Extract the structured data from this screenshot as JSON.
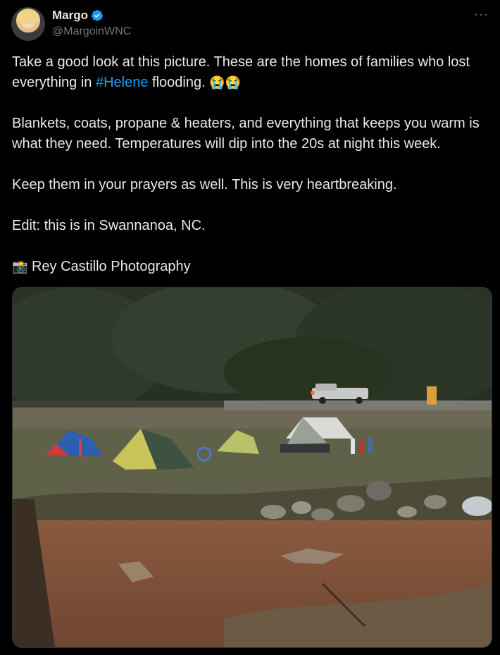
{
  "author": {
    "name": "Margo",
    "handle": "@MargoinWNC",
    "verified": true
  },
  "more_icon": "more-horizontal-icon",
  "tweet": {
    "line1_prefix": "Take a good look at this picture. These are the homes of families who lost everything in ",
    "hashtag": "#Helene",
    "line1_suffix": " flooding. ",
    "emoji1": "😭😭",
    "para2": "Blankets, coats, propane & heaters, and everything that keeps you warm is what they need. Temperatures will dip into the 20s at night this week.",
    "para3": "Keep them in your prayers as well. This is very heartbreaking.",
    "para4": "Edit: this is in Swannanoa, NC.",
    "credit_emoji": "📸",
    "credit": " Rey Castillo Photography"
  },
  "colors": {
    "accent": "#1d9bf0",
    "text": "#e7e9ea",
    "muted": "#71767b",
    "background": "#000000"
  }
}
